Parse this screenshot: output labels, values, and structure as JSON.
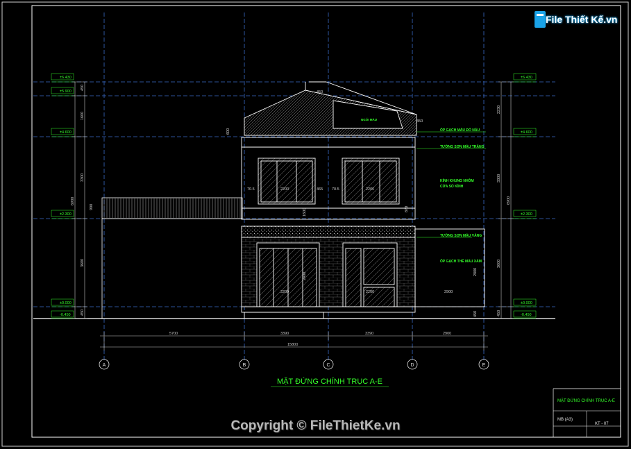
{
  "title": "MẶT ĐỨNG CHÍNH TRỤC A-E",
  "logo": "File Thiết Kế.vn",
  "copyright": "Copyright © FileThietKe.vn",
  "title_block": {
    "sheet_title": "MẶT ĐỨNG CHÍNH TRỤC A-E",
    "scale": "MB (A3)",
    "sheet_no": "KT - 07"
  },
  "colors": {
    "background": "#000000",
    "lines": "#ffffff",
    "grid": "#3a6cc8",
    "annotation": "#35ff2a",
    "dimension": "#c8c8c8"
  },
  "axes": [
    "A",
    "B",
    "C",
    "D",
    "E"
  ],
  "axis_dims": [
    "5700",
    "3390",
    "3390",
    "2900"
  ],
  "total_dim": "15800",
  "levels_left": [
    "±6.430",
    "±5.900",
    "±4.600",
    "±2.300",
    "±0.000",
    "-0.450"
  ],
  "levels_right": [
    "±6.430",
    "±4.600",
    "±2.300",
    "±0.000",
    "-0.450"
  ],
  "left_dims_inner": [
    "450",
    "1600",
    "3300",
    "3600",
    "450"
  ],
  "left_dims_outer": [
    "6900"
  ],
  "right_dims_inner": [
    "2230",
    "3300",
    "3600",
    "450"
  ],
  "right_dims_outer": [
    "6900"
  ],
  "small_dims": {
    "roof_top": "450",
    "roof_right": "450",
    "upper_left": "70.5",
    "upper_w1": "2200",
    "upper_mid": "465",
    "upper_mid2": "70.5",
    "upper_w2": "2200",
    "lower_w1": "2200",
    "lower_w2": "2200",
    "lower_span": "2900",
    "fence_h": "900",
    "roof_h": "600",
    "side_v1": "1600",
    "side_v2": "870",
    "side_v3": "2400",
    "right_house_h": "2800",
    "right_base": "450"
  },
  "notes": [
    "ỐP GẠCH MÀU ĐỎ NÂU",
    "TƯỜNG SƠN MÀU TRẮNG",
    "KÍNH KHUNG NHÔM",
    "CỬA SỔ KÍNH",
    "TƯỜNG SƠN MÀU VÀNG",
    "ỐP GẠCH THẺ MÀU XÁM"
  ],
  "roof_note": "NGÓI MÀU"
}
